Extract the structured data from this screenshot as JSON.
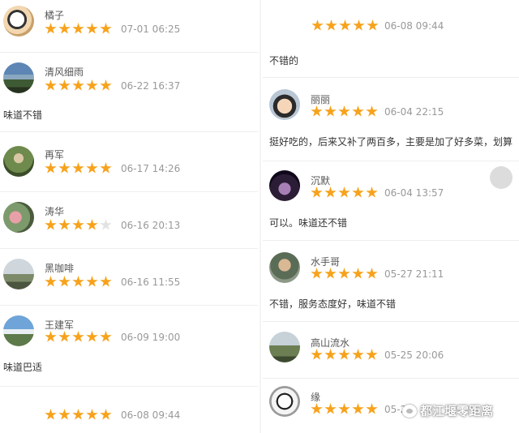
{
  "colors": {
    "star_filled": "#f7a21b",
    "star_empty": "#e2e2e2"
  },
  "left_reviews": [
    {
      "name": "橘子",
      "rating": 5,
      "time": "07-01 06:25",
      "comment": ""
    },
    {
      "name": "清风细雨",
      "rating": 5,
      "time": "06-22 16:37",
      "comment": "味道不错"
    },
    {
      "name": "再军",
      "rating": 5,
      "time": "06-17 14:26",
      "comment": ""
    },
    {
      "name": "涛华",
      "rating": 4,
      "time": "06-16 20:13",
      "comment": ""
    },
    {
      "name": "黑咖啡",
      "rating": 5,
      "time": "06-16 11:55",
      "comment": ""
    },
    {
      "name": "王建军",
      "rating": 5,
      "time": "06-09 19:00",
      "comment": "味道巴适"
    },
    {
      "name": "",
      "rating": 5,
      "time": "06-08 09:44",
      "comment": ""
    }
  ],
  "right_reviews": [
    {
      "name": "",
      "rating": 5,
      "time": "06-08 09:44",
      "comment": "不错的"
    },
    {
      "name": "丽丽",
      "rating": 5,
      "time": "06-04 22:15",
      "comment": "挺好吃的，后来又补了两百多，主要是加了好多菜，划算"
    },
    {
      "name": "沉默",
      "rating": 5,
      "time": "06-04 13:57",
      "comment": "可以。味道还不错"
    },
    {
      "name": "水手哥",
      "rating": 5,
      "time": "05-27 21:11",
      "comment": "不错，服务态度好，味道不错"
    },
    {
      "name": "高山流水",
      "rating": 5,
      "time": "05-25 20:06",
      "comment": ""
    },
    {
      "name": "缘",
      "rating": 5,
      "time": "05-2",
      "comment": ""
    }
  ],
  "watermark": {
    "text": "都江堰零距离"
  }
}
